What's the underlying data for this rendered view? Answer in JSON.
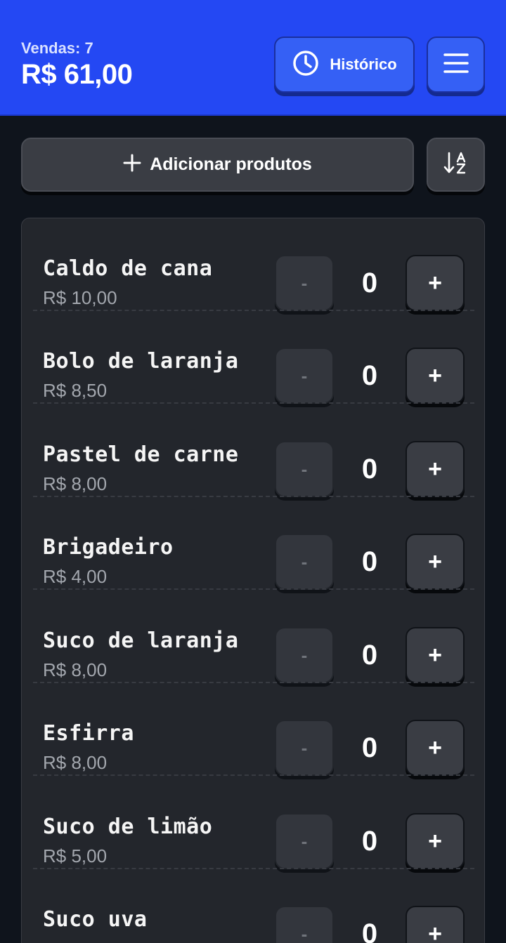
{
  "header": {
    "sales_count": "Vendas: 7",
    "sales_total": "R$ 61,00",
    "history_label": "Histórico",
    "history_icon": "clock-icon",
    "menu_icon": "hamburger-menu-icon",
    "background_color": "#2448f3"
  },
  "toolbar": {
    "add_label": "Adicionar produtos",
    "add_icon": "plus-icon",
    "sort_icon": "sort-alphabetical-icon"
  },
  "products": [
    {
      "name": "Caldo de cana",
      "price": "R$ 10,00",
      "qty": "0",
      "minus": "-",
      "plus": "+"
    },
    {
      "name": "Bolo de laranja",
      "price": "R$ 8,50",
      "qty": "0",
      "minus": "-",
      "plus": "+"
    },
    {
      "name": "Pastel de carne",
      "price": "R$ 8,00",
      "qty": "0",
      "minus": "-",
      "plus": "+"
    },
    {
      "name": "Brigadeiro",
      "price": "R$ 4,00",
      "qty": "0",
      "minus": "-",
      "plus": "+"
    },
    {
      "name": "Suco de laranja",
      "price": "R$ 8,00",
      "qty": "0",
      "minus": "-",
      "plus": "+"
    },
    {
      "name": "Esfirra",
      "price": "R$ 8,00",
      "qty": "0",
      "minus": "-",
      "plus": "+"
    },
    {
      "name": "Suco de limão",
      "price": "R$ 5,00",
      "qty": "0",
      "minus": "-",
      "plus": "+"
    },
    {
      "name": "Suco uva",
      "price": "",
      "qty": "0",
      "minus": "-",
      "plus": "+"
    }
  ]
}
